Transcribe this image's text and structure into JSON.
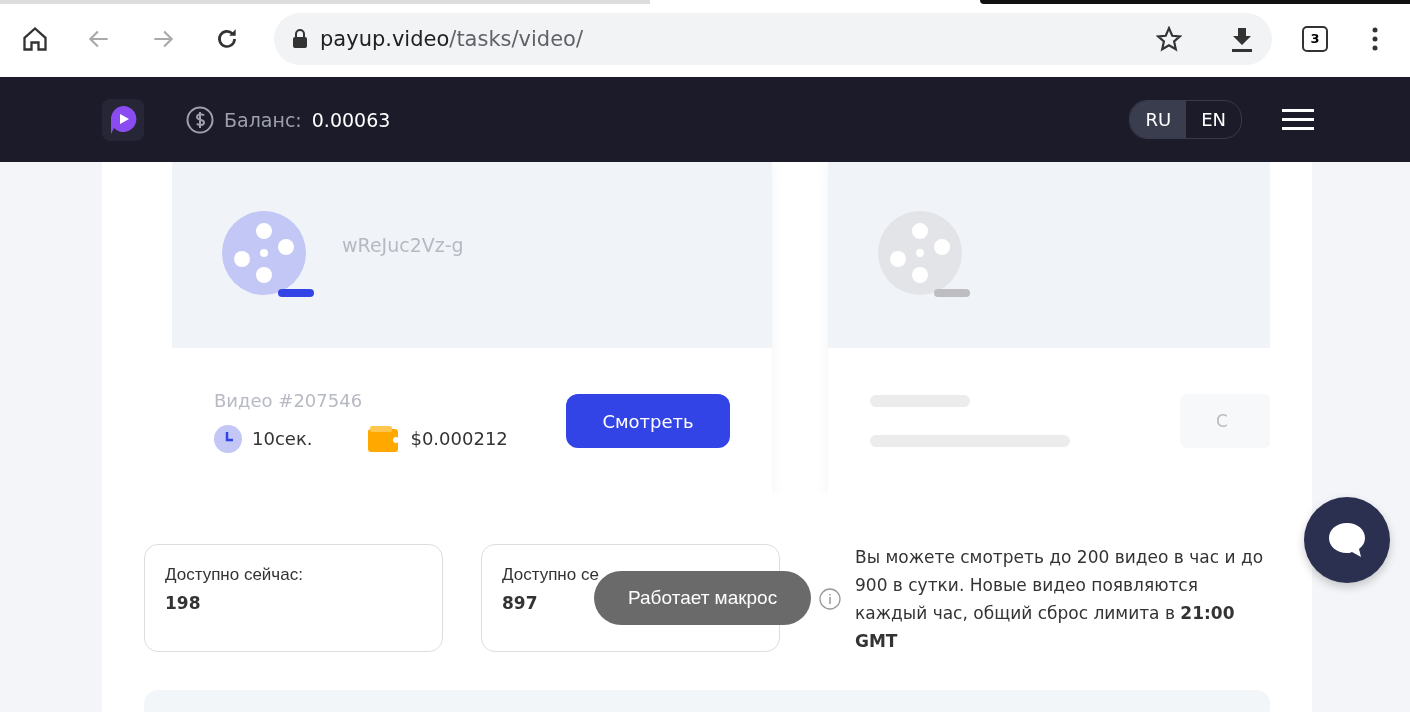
{
  "browser": {
    "url_host": "payup.video",
    "url_path": "/tasks/video/",
    "tab_count": "3"
  },
  "header": {
    "balance_label": "Баланс:",
    "balance_value": "0.00063",
    "languages": [
      {
        "label": "RU",
        "selected": true
      },
      {
        "label": "EN",
        "selected": false
      }
    ]
  },
  "videos": [
    {
      "kind": "loaded",
      "video_id": "wReJuc2Vz-g",
      "title": "Видео #207546",
      "duration": "10сек.",
      "reward": "$0.000212",
      "button": "Смотреть"
    },
    {
      "kind": "loading",
      "button": "С"
    }
  ],
  "stats": [
    {
      "label": "Доступно сейчас:",
      "value": "198"
    },
    {
      "label": "Доступно се",
      "value": "897"
    }
  ],
  "info": "Вы можете смотреть до 200 видео в час и до 900 в сутки. Новые видео появляются каждый час, общий сброс лимита в **21:00 GMT**",
  "toast": "Работает макрос"
}
